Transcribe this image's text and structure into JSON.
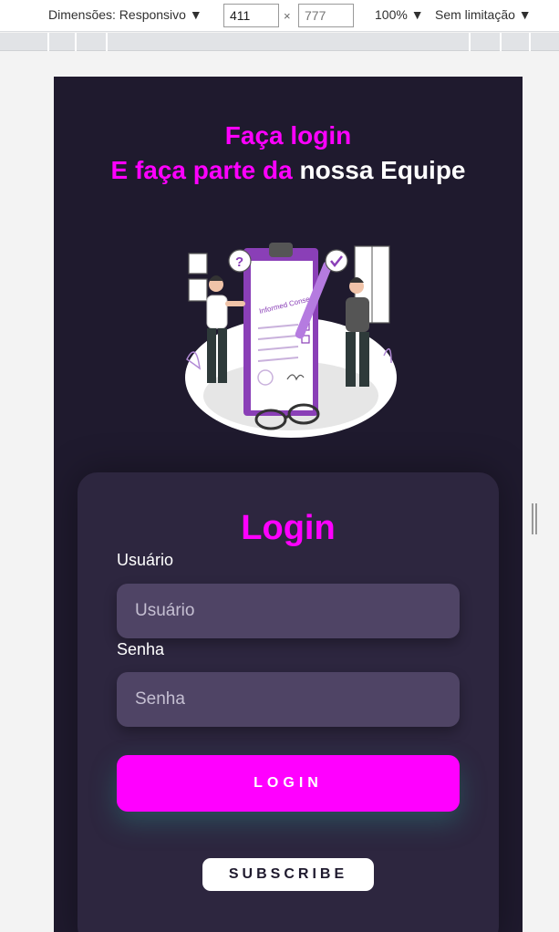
{
  "devtools": {
    "dimensions_label": "Dimensões: Responsivo ▼",
    "width_value": "411",
    "height_value": "777",
    "times": "×",
    "zoom": "100% ▼",
    "throttle": "Sem limitação ▼"
  },
  "page": {
    "headline_line1": "Faça login",
    "headline_line2_accent": "E faça parte da",
    "headline_line2_white": " nossa Equipe",
    "illustration_text": "Informed Consent"
  },
  "login_card": {
    "title": "Login",
    "username_label": "Usuário",
    "username_placeholder": "Usuário",
    "password_label": "Senha",
    "password_placeholder": "Senha",
    "login_button": "LOGIN",
    "subscribe_button": "SUBSCRIBE"
  },
  "colors": {
    "background": "#1f1a2e",
    "card": "#2d263f",
    "accent": "#ff00ff",
    "field": "#4f4465"
  }
}
